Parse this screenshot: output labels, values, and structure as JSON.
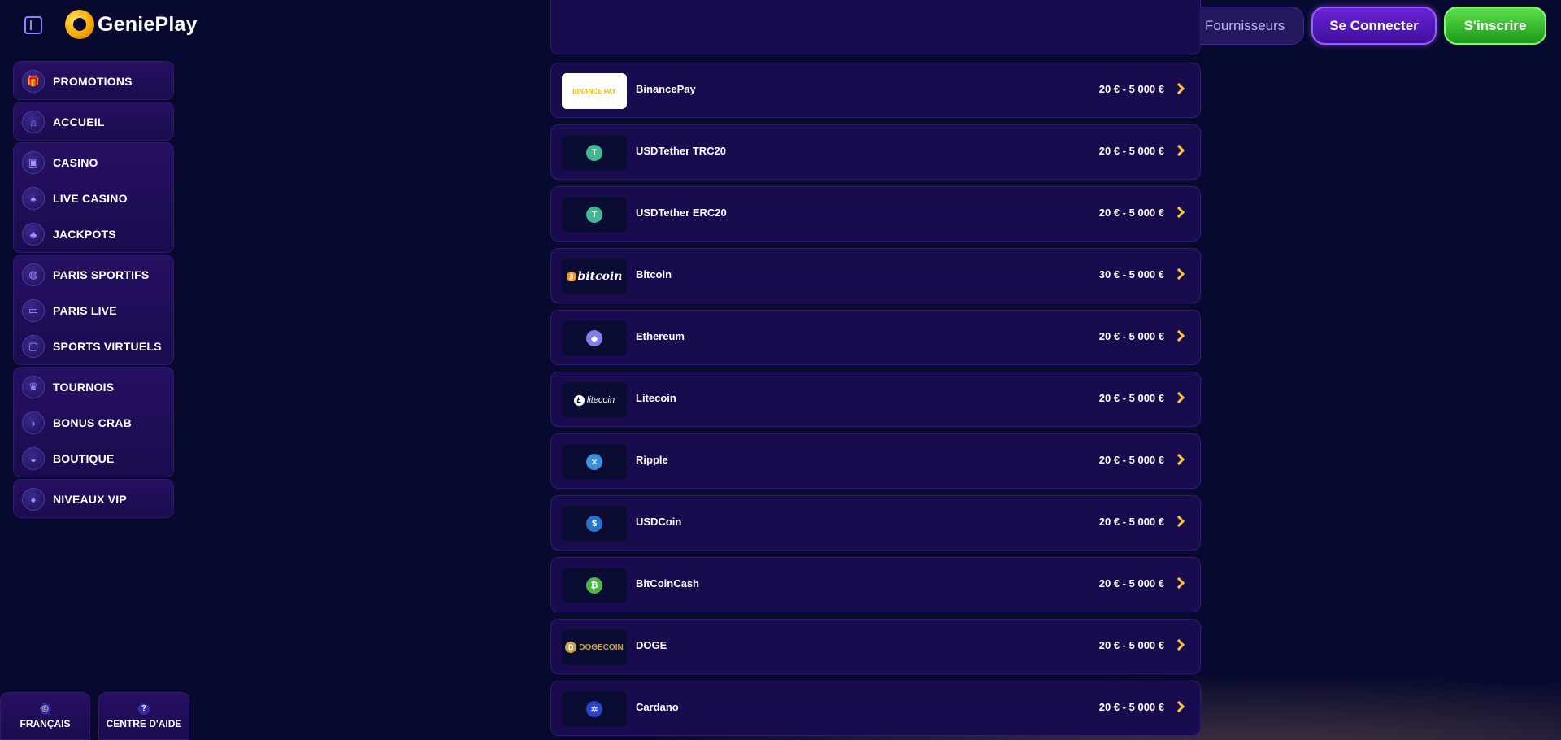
{
  "header": {
    "logo_text": "GeniePlay",
    "search_placeholder": "Jeux, Catégories, Fournisseurs",
    "login_label": "Se Connecter",
    "signup_label": "S'inscrire"
  },
  "sidebar": {
    "groups": [
      [
        {
          "label": "PROMOTIONS",
          "icon": "gift-icon"
        }
      ],
      [
        {
          "label": "ACCUEIL",
          "icon": "home-icon"
        }
      ],
      [
        {
          "label": "CASINO",
          "icon": "slot-machine-icon"
        },
        {
          "label": "LIVE CASINO",
          "icon": "playing-card-icon"
        },
        {
          "label": "JACKPOTS",
          "icon": "clover-icon"
        }
      ],
      [
        {
          "label": "PARIS SPORTIFS",
          "icon": "ball-icon"
        },
        {
          "label": "PARIS LIVE",
          "icon": "live-icon"
        },
        {
          "label": "SPORTS VIRTUELS",
          "icon": "monitor-icon"
        }
      ],
      [
        {
          "label": "TOURNOIS",
          "icon": "trophy-icon"
        },
        {
          "label": "BONUS CRAB",
          "icon": "crab-icon"
        },
        {
          "label": "BOUTIQUE",
          "icon": "basket-icon"
        }
      ],
      [
        {
          "label": "NIVEAUX VIP",
          "icon": "diamond-icon"
        }
      ]
    ],
    "footer": {
      "language_label": "FRANÇAIS",
      "help_label": "CENTRE D'AIDE"
    }
  },
  "payment_methods": [
    {
      "name": "BinancePay",
      "range": "20 € - 5 000 €",
      "logo": "binance-pay-logo",
      "logo_text": "BINANCE PAY"
    },
    {
      "name": "USDTether TRC20",
      "range": "20 € - 5 000 €",
      "logo": "tether-icon",
      "color": "#3fb893"
    },
    {
      "name": "USDTether ERC20",
      "range": "20 € - 5 000 €",
      "logo": "tether-icon",
      "color": "#3fb893"
    },
    {
      "name": "Bitcoin",
      "range": "30 € - 5 000 €",
      "logo": "bitcoin-logo",
      "logo_text": "bitcoin"
    },
    {
      "name": "Ethereum",
      "range": "20 € - 5 000 €",
      "logo": "ethereum-icon",
      "color": "#7f7fe8"
    },
    {
      "name": "Litecoin",
      "range": "20 € - 5 000 €",
      "logo": "litecoin-logo",
      "logo_text": "litecoin"
    },
    {
      "name": "Ripple",
      "range": "20 € - 5 000 €",
      "logo": "ripple-icon",
      "color": "#3a8fd8"
    },
    {
      "name": "USDCoin",
      "range": "20 € - 5 000 €",
      "logo": "usdc-icon",
      "color": "#2775ca"
    },
    {
      "name": "BitCoinCash",
      "range": "20 € - 5 000 €",
      "logo": "bitcoin-cash-icon",
      "color": "#4fb549"
    },
    {
      "name": "DOGE",
      "range": "20 € - 5 000 €",
      "logo": "dogecoin-logo",
      "logo_text": "DOGECOIN"
    },
    {
      "name": "Cardano",
      "range": "20 € - 5 000 €",
      "logo": "cardano-icon",
      "color": "#2a41c8"
    }
  ]
}
